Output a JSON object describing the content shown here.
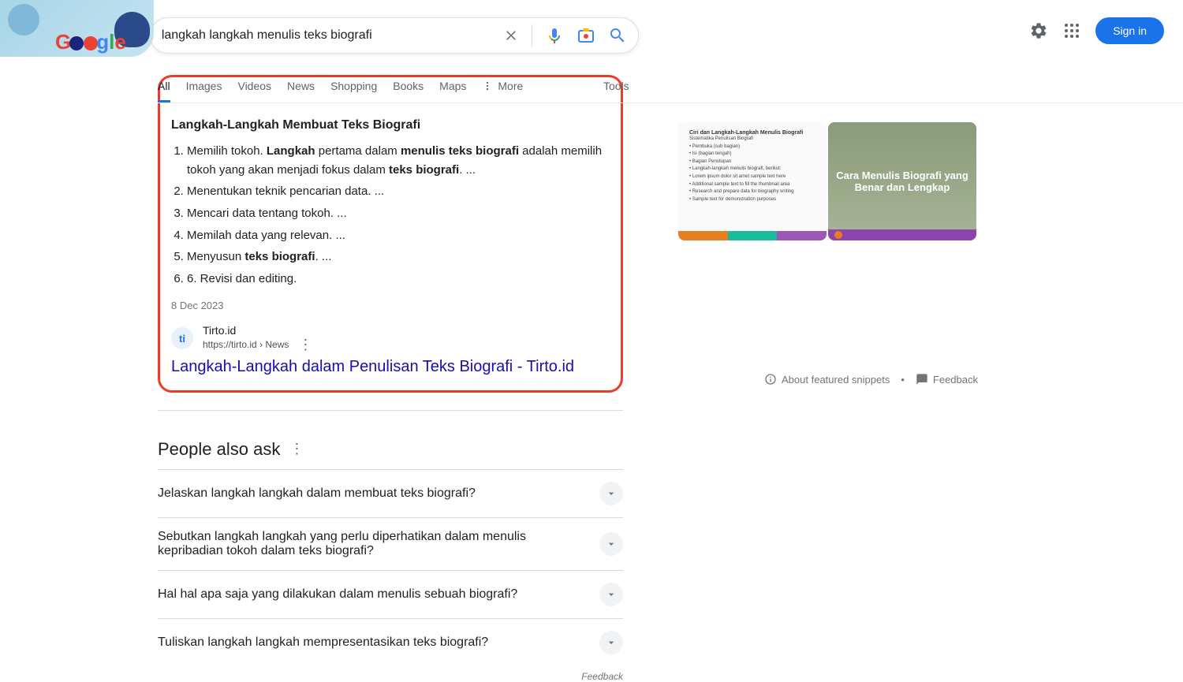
{
  "search": {
    "query": "langkah langkah menulis teks biografi"
  },
  "header_right": {
    "sign_in": "Sign in"
  },
  "tabs": {
    "all": "All",
    "images": "Images",
    "videos": "Videos",
    "news": "News",
    "shopping": "Shopping",
    "books": "Books",
    "maps": "Maps",
    "more": "More",
    "tools": "Tools"
  },
  "featured": {
    "heading": "Langkah-Langkah Membuat Teks Biografi",
    "items": [
      {
        "pre": "Memilih tokoh. ",
        "b1": "Langkah",
        "mid1": " pertama dalam ",
        "b2": "menulis teks biografi",
        "mid2": " adalah memilih tokoh yang akan menjadi fokus dalam ",
        "b3": "teks biografi",
        "post": ". ..."
      },
      {
        "plain": "Menentukan teknik pencarian data. ..."
      },
      {
        "plain": "Mencari data tentang tokoh. ..."
      },
      {
        "plain": "Memilah data yang relevan. ..."
      },
      {
        "pre": "Menyusun ",
        "b1": "teks biografi",
        "post": ". ..."
      },
      {
        "plain": "6. Revisi dan editing."
      }
    ],
    "date": "8 Dec 2023",
    "source": {
      "name": "Tirto.id",
      "url": "https://tirto.id › News",
      "favicon": "ti",
      "title": "Langkah-Langkah dalam Penulisan Teks Biografi - Tirto.id"
    }
  },
  "paa": {
    "title": "People also ask",
    "questions": [
      "Jelaskan langkah langkah dalam membuat teks biografi?",
      "Sebutkan langkah langkah yang perlu diperhatikan dalam menulis kepribadian tokoh dalam teks biografi?",
      "Hal hal apa saja yang dilakukan dalam menulis sebuah biografi?",
      "Tuliskan langkah langkah mempresentasikan teks biografi?"
    ],
    "feedback": "Feedback"
  },
  "side": {
    "thumb2_text": "Cara Menulis Biografi yang Benar dan Lengkap",
    "about_snippets": "About featured snippets",
    "feedback": "Feedback"
  }
}
